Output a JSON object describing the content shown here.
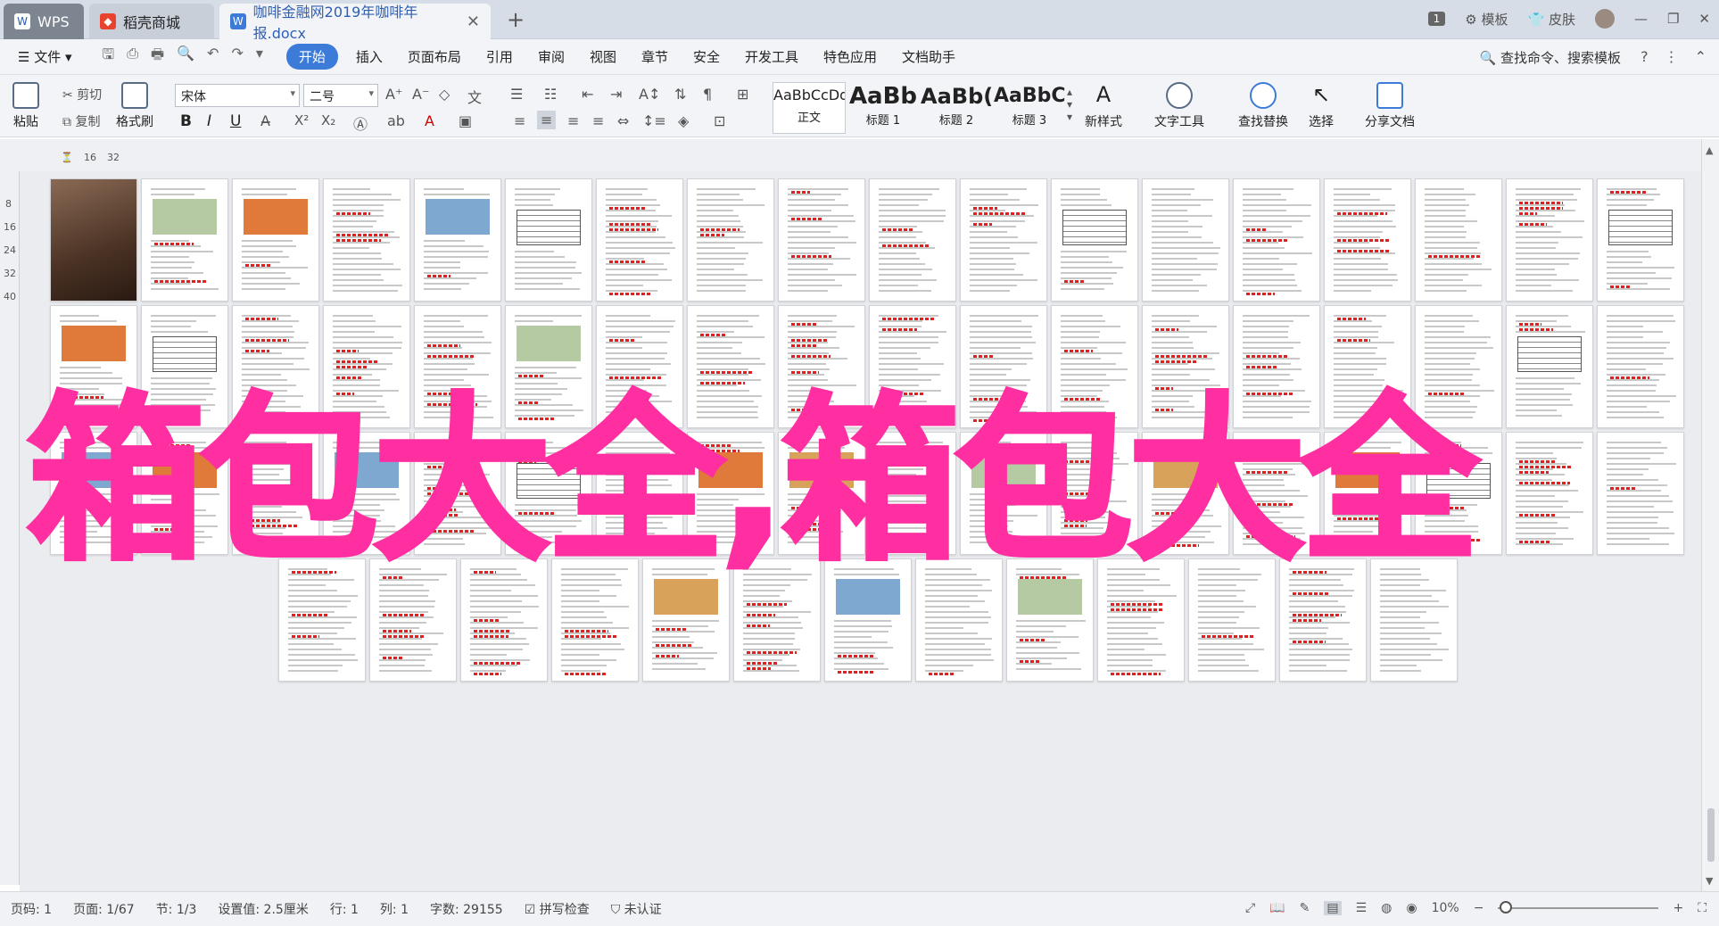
{
  "tabs": {
    "wps": "WPS",
    "store": "稻壳商城",
    "document": "咖啡金融网2019年咖啡年报.docx",
    "add": "+",
    "close": "✕"
  },
  "window_right": {
    "badge": "1",
    "template": "模板",
    "skin": "皮肤",
    "minimize": "—",
    "restore": "❐",
    "close": "✕"
  },
  "menu": {
    "file": "文件",
    "items": [
      "开始",
      "插入",
      "页面布局",
      "引用",
      "审阅",
      "视图",
      "章节",
      "安全",
      "开发工具",
      "特色应用",
      "文档助手"
    ],
    "search": "查找命令、搜索模板",
    "help": "?"
  },
  "ribbon": {
    "paste": "粘贴",
    "cut": "剪切",
    "copy": "复制",
    "format_painter": "格式刷",
    "font_name": "宋体",
    "font_size": "二号",
    "bold": "B",
    "italic": "I",
    "underline": "U",
    "styles": [
      {
        "sample": "AaBbCcDd",
        "label": "正文"
      },
      {
        "sample": "AaBb",
        "label": "标题 1"
      },
      {
        "sample": "AaBb(",
        "label": "标题 2"
      },
      {
        "sample": "AaBbC",
        "label": "标题 3"
      }
    ],
    "new_style": "新样式",
    "text_tools": "文字工具",
    "find_replace": "查找替换",
    "select": "选择",
    "share": "分享文档"
  },
  "ruler": {
    "top": [
      "16",
      "32"
    ],
    "left": [
      "8",
      "16",
      "24",
      "32",
      "40"
    ]
  },
  "watermark": "箱包大全,箱包大全",
  "status": {
    "page_num": "页码: 1",
    "pages": "页面: 1/67",
    "section": "节: 1/3",
    "setting": "设置值: 2.5厘米",
    "row": "行: 1",
    "col": "列: 1",
    "words": "字数: 29155",
    "spell": "拼写检查",
    "cert": "未认证",
    "zoom": "10%",
    "zoom_fraction": 0.05
  },
  "colors": {
    "accent": "#3d7bd9",
    "watermark": "#ff2fa1"
  }
}
